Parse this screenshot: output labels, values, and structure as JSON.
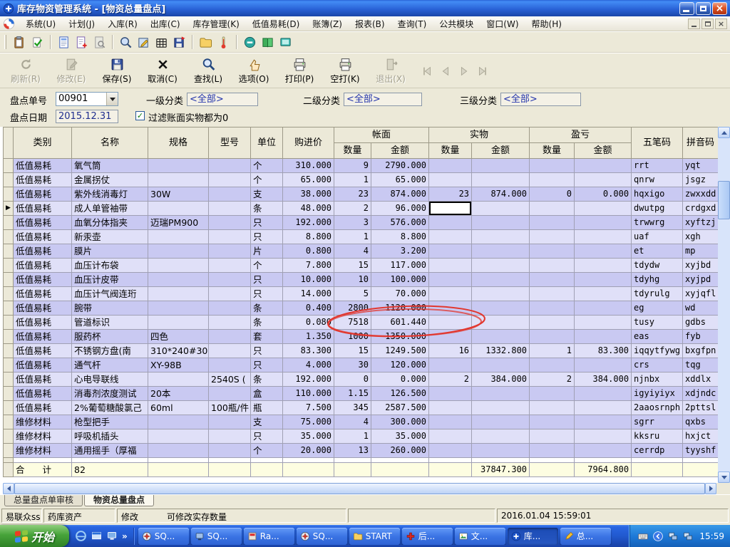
{
  "window": {
    "title": "库存物资管理系统 - [物资总量盘点]"
  },
  "menu": {
    "items": [
      "系统(U)",
      "计划(J)",
      "入库(R)",
      "出库(C)",
      "库存管理(K)",
      "低值易耗(D)",
      "账簿(Z)",
      "报表(B)",
      "查询(T)",
      "公共模块",
      "窗口(W)",
      "帮助(H)"
    ]
  },
  "toolbar_small": {
    "icons": [
      {
        "name": "paste-icon"
      },
      {
        "name": "validate-icon"
      },
      {
        "sep": true
      },
      {
        "name": "report-icon"
      },
      {
        "name": "doc-add-icon"
      },
      {
        "name": "doc-find-icon"
      },
      {
        "sep": true
      },
      {
        "name": "zoom-icon"
      },
      {
        "name": "pad-edit-icon"
      },
      {
        "name": "grid-icon"
      },
      {
        "name": "save-export-icon"
      },
      {
        "sep": true
      },
      {
        "name": "folder-icon"
      },
      {
        "name": "thermometer-icon"
      },
      {
        "sep": true
      },
      {
        "name": "stop-icon"
      },
      {
        "name": "book-icon"
      },
      {
        "name": "screen-icon"
      }
    ]
  },
  "toolbar_main": {
    "buttons": [
      {
        "label": "刷新(R)",
        "icon": "refresh-icon",
        "enabled": false
      },
      {
        "label": "修改(E)",
        "icon": "modify-icon",
        "enabled": false
      },
      {
        "label": "保存(S)",
        "icon": "save-icon",
        "enabled": true
      },
      {
        "label": "取消(C)",
        "icon": "cancel-icon",
        "enabled": true
      },
      {
        "label": "查找(L)",
        "icon": "find-icon",
        "enabled": true
      },
      {
        "label": "选项(O)",
        "icon": "options-icon",
        "enabled": true
      },
      {
        "label": "打印(P)",
        "icon": "print-icon",
        "enabled": true
      },
      {
        "label": "空打(K)",
        "icon": "print-icon",
        "enabled": true
      },
      {
        "label": "退出(X)",
        "icon": "exit-icon",
        "enabled": false
      }
    ],
    "nav": [
      "nav-first-icon",
      "nav-prev-icon",
      "nav-next-icon",
      "nav-last-icon"
    ]
  },
  "filters": {
    "doc_no_label": "盘点单号",
    "doc_no_value": "00901",
    "cat1_label": "一级分类",
    "cat1_value": "<全部>",
    "cat2_label": "二级分类",
    "cat2_value": "<全部>",
    "cat3_label": "三级分类",
    "cat3_value": "<全部>",
    "date_label": "盘点日期",
    "date_value": "2015.12.31",
    "filter_zero_label": "过滤账面实物都为0",
    "filter_zero_checked": true
  },
  "grid": {
    "headers": {
      "category": "类别",
      "name": "名称",
      "spec": "规格",
      "model": "型号",
      "unit": "单位",
      "price": "购进价",
      "book_group": "帐面",
      "actual_group": "实物",
      "diff_group": "盈亏",
      "qty": "数量",
      "amount": "金额",
      "wubi": "五笔码",
      "pinyin": "拼音码"
    },
    "rows": [
      [
        "低值易耗",
        "氧气筒",
        "",
        "",
        "个",
        "310.000",
        "9",
        "2790.000",
        "",
        "",
        "",
        "",
        "rrt",
        "yqt"
      ],
      [
        "低值易耗",
        "金属拐仗",
        "",
        "",
        "个",
        "65.000",
        "1",
        "65.000",
        "",
        "",
        "",
        "",
        "qnrw",
        "jsgz"
      ],
      [
        "低值易耗",
        "紫外线消毒灯",
        "30W",
        "",
        "支",
        "38.000",
        "23",
        "874.000",
        "23",
        "874.000",
        "0",
        "0.000",
        "hqxigo",
        "zwxxdd"
      ],
      [
        "低值易耗",
        "成人单管袖带",
        "",
        "",
        "条",
        "48.000",
        "2",
        "96.000",
        "",
        "",
        "",
        "",
        "dwutpg",
        "crdgxd"
      ],
      [
        "低值易耗",
        "血氧分体指夹",
        "迈瑞PM900",
        "",
        "只",
        "192.000",
        "3",
        "576.000",
        "",
        "",
        "",
        "",
        "trwwrg",
        "xyftzj"
      ],
      [
        "低值易耗",
        "新汞壶",
        "",
        "",
        "只",
        "8.800",
        "1",
        "8.800",
        "",
        "",
        "",
        "",
        "uaf",
        "xgh"
      ],
      [
        "低值易耗",
        "膜片",
        "",
        "",
        "片",
        "0.800",
        "4",
        "3.200",
        "",
        "",
        "",
        "",
        "et",
        "mp"
      ],
      [
        "低值易耗",
        "血压计布袋",
        "",
        "",
        "个",
        "7.800",
        "15",
        "117.000",
        "",
        "",
        "",
        "",
        "tdydw",
        "xyjbd"
      ],
      [
        "低值易耗",
        "血压计皮带",
        "",
        "",
        "只",
        "10.000",
        "10",
        "100.000",
        "",
        "",
        "",
        "",
        "tdyhg",
        "xyjpd"
      ],
      [
        "低值易耗",
        "血压计气阀连珩",
        "",
        "",
        "只",
        "14.000",
        "5",
        "70.000",
        "",
        "",
        "",
        "",
        "tdyrulg",
        "xyjqfl"
      ],
      [
        "低值易耗",
        "腕带",
        "",
        "",
        "条",
        "0.400",
        "2800",
        "1120.000",
        "",
        "",
        "",
        "",
        "eg",
        "wd"
      ],
      [
        "低值易耗",
        "管道标识",
        "",
        "",
        "条",
        "0.080",
        "7518",
        "601.440",
        "",
        "",
        "",
        "",
        "tusy",
        "gdbs"
      ],
      [
        "低值易耗",
        "服药杯",
        "四色",
        "",
        "套",
        "1.350",
        "1000",
        "1350.000",
        "",
        "",
        "",
        "",
        "eas",
        "fyb"
      ],
      [
        "低值易耗",
        "不锈钢方盘(南",
        "310*240#30",
        "",
        "只",
        "83.300",
        "15",
        "1249.500",
        "16",
        "1332.800",
        "1",
        "83.300",
        "iqqytfywg",
        "bxgfpn"
      ],
      [
        "低值易耗",
        "通气杆",
        "XY-98B",
        "",
        "只",
        "4.000",
        "30",
        "120.000",
        "",
        "",
        "",
        "",
        "crs",
        "tqg"
      ],
      [
        "低值易耗",
        "心电导联线",
        "",
        "2540S (",
        "条",
        "192.000",
        "0",
        "0.000",
        "2",
        "384.000",
        "2",
        "384.000",
        "njnbx",
        "xddlx"
      ],
      [
        "低值易耗",
        "消毒剂浓度测试",
        "20本",
        "",
        "盒",
        "110.000",
        "1.15",
        "126.500",
        "",
        "",
        "",
        "",
        "igyiyiyx",
        "xdjndc"
      ],
      [
        "低值易耗",
        "2%葡萄糖酸氯己",
        "60ml",
        "100瓶/件",
        "瓶",
        "7.500",
        "345",
        "2587.500",
        "",
        "",
        "",
        "",
        "2aaosrnph",
        "2pttsl"
      ],
      [
        "维修材料",
        "枪型把手",
        "",
        "",
        "支",
        "75.000",
        "4",
        "300.000",
        "",
        "",
        "",
        "",
        "sgrr",
        "qxbs"
      ],
      [
        "维修材料",
        "呼吸机插头",
        "",
        "",
        "只",
        "35.000",
        "1",
        "35.000",
        "",
        "",
        "",
        "",
        "kksru",
        "hxjct"
      ],
      [
        "维修材料",
        "通用摇手（厚福",
        "",
        "",
        "个",
        "20.000",
        "13",
        "260.000",
        "",
        "",
        "",
        "",
        "cerrdp",
        "tyyshf"
      ]
    ],
    "selected_row_index": 3,
    "focused_cell": {
      "row_index": 3,
      "col_index": 8
    },
    "totals": {
      "label": "合　　计",
      "name": "82",
      "actual_amount": "37847.300",
      "diff_amount": "7964.800"
    }
  },
  "tabs": {
    "items": [
      {
        "label": "总量盘点单审核",
        "active": false
      },
      {
        "label": "物资总量盘点",
        "active": true
      }
    ]
  },
  "statusbar": {
    "panels": [
      {
        "text": "易联众ss"
      },
      {
        "text": "药库资产"
      },
      {
        "text": "修改",
        "text2": "可修改实存数量"
      },
      {
        "text": ""
      },
      {
        "text": "2016.01.04 15:59:01"
      }
    ]
  },
  "taskbar": {
    "start_label": "开始",
    "quick_launch": [
      "ie-icon",
      "window-icon",
      "desktop-icon"
    ],
    "more_chevron": "»",
    "buttons": [
      {
        "icon": "compass-icon",
        "label": "SQ...",
        "active": false
      },
      {
        "icon": "monitor-icon",
        "label": "SQ...",
        "active": false
      },
      {
        "icon": "ra-app-icon",
        "label": "Ra...",
        "active": false
      },
      {
        "icon": "compass-icon",
        "label": "SQ...",
        "active": false
      },
      {
        "icon": "folder-icon",
        "label": "START",
        "active": false
      },
      {
        "icon": "red-cross-icon",
        "label": "后...",
        "active": false
      },
      {
        "icon": "image-icon",
        "label": "文...",
        "active": false
      },
      {
        "icon": "app-plus-icon",
        "label": "库...",
        "active": true
      },
      {
        "icon": "pen-icon",
        "label": "总...",
        "active": false
      }
    ],
    "tray_icons": [
      "keyboard-icon",
      "collapse-icon",
      "net-icon",
      "net-icon"
    ],
    "time": "15:59"
  },
  "colors": {
    "row_odd": "#c9c9f2",
    "row_even": "#e0e0f8",
    "total_row": "#fdfde1",
    "annotation": "#e2372e",
    "grid_line": "#a0a0b4",
    "titlebar_text": "#ffffff"
  }
}
